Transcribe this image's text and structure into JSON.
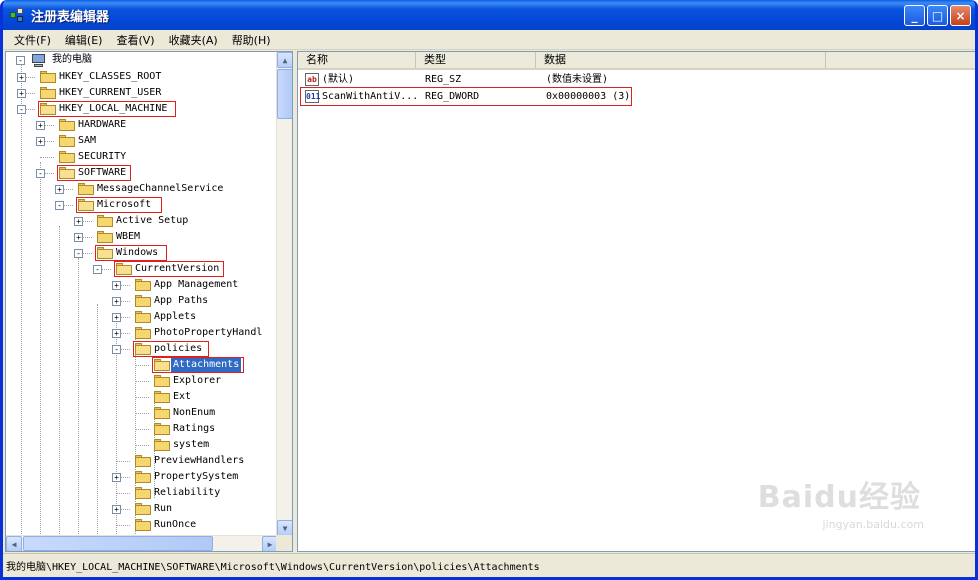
{
  "window": {
    "title": "注册表编辑器",
    "controls": {
      "minimize": "_",
      "maximize": "□",
      "close": "×"
    }
  },
  "menu": [
    "文件(F)",
    "编辑(E)",
    "查看(V)",
    "收藏夹(A)",
    "帮助(H)"
  ],
  "tree": {
    "root": "我的电脑",
    "nodes": [
      {
        "label": "HKEY_CLASSES_ROOT",
        "expander": "+"
      },
      {
        "label": "HKEY_CURRENT_USER",
        "expander": "+"
      },
      {
        "label": "HKEY_LOCAL_MACHINE",
        "expander": "-",
        "highlighted": true
      },
      {
        "label": "HARDWARE",
        "expander": "+"
      },
      {
        "label": "SAM",
        "expander": "+"
      },
      {
        "label": "SECURITY",
        "expander": ""
      },
      {
        "label": "SOFTWARE",
        "expander": "-",
        "highlighted": true
      },
      {
        "label": "MessageChannelService",
        "expander": "+"
      },
      {
        "label": "Microsoft",
        "expander": "-",
        "highlighted": true
      },
      {
        "label": "Active Setup",
        "expander": "+"
      },
      {
        "label": "WBEM",
        "expander": "+"
      },
      {
        "label": "Windows",
        "expander": "-",
        "highlighted": true
      },
      {
        "label": "CurrentVersion",
        "expander": "-",
        "highlighted": true
      },
      {
        "label": "App Management",
        "expander": "+"
      },
      {
        "label": "App Paths",
        "expander": "+"
      },
      {
        "label": "Applets",
        "expander": "+"
      },
      {
        "label": "PhotoPropertyHandl",
        "expander": "+"
      },
      {
        "label": "policies",
        "expander": "-",
        "highlighted": true
      },
      {
        "label": "Attachments",
        "expander": "",
        "highlighted": true,
        "selected": true
      },
      {
        "label": "Explorer",
        "expander": ""
      },
      {
        "label": "Ext",
        "expander": ""
      },
      {
        "label": "NonEnum",
        "expander": ""
      },
      {
        "label": "Ratings",
        "expander": ""
      },
      {
        "label": "system",
        "expander": ""
      },
      {
        "label": "PreviewHandlers",
        "expander": ""
      },
      {
        "label": "PropertySystem",
        "expander": "+"
      },
      {
        "label": "Reliability",
        "expander": ""
      },
      {
        "label": "Run",
        "expander": "+"
      },
      {
        "label": "RunOnce",
        "expander": ""
      }
    ]
  },
  "list": {
    "columns": [
      "名称",
      "类型",
      "数据"
    ],
    "rows": [
      {
        "icon": "string-value-icon",
        "icon_text": "ab",
        "name": "(默认)",
        "type": "REG_SZ",
        "data": "(数值未设置)"
      },
      {
        "icon": "dword-value-icon",
        "icon_text": "011",
        "name": "ScanWithAntiV...",
        "type": "REG_DWORD",
        "data": "0x00000003 (3)",
        "highlighted": true
      }
    ]
  },
  "status": {
    "path": "我的电脑\\HKEY_LOCAL_MACHINE\\SOFTWARE\\Microsoft\\Windows\\CurrentVersion\\policies\\Attachments"
  },
  "watermark": {
    "logo": "Baidu经验",
    "url": "jingyan.baidu.com"
  },
  "colors": {
    "titlebar": "#0a54dd",
    "selection": "#316ac5",
    "highlight_box": "#e02020"
  }
}
